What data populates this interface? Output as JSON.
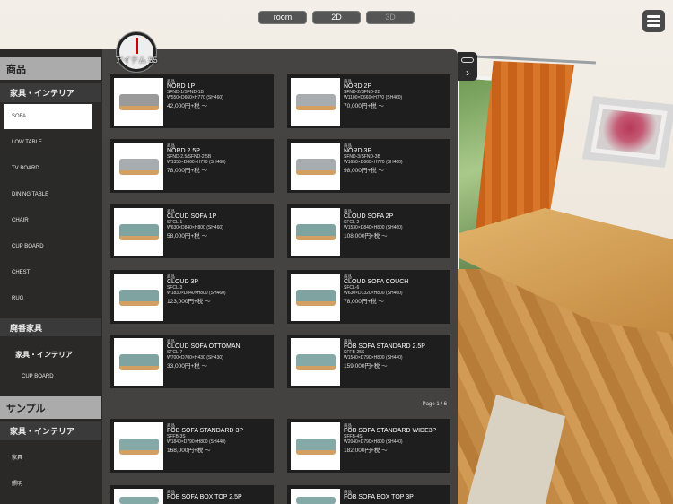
{
  "topbar": {
    "buttons": [
      {
        "label": "room"
      },
      {
        "label": "2D"
      },
      {
        "label": "3D"
      }
    ]
  },
  "sidebar": {
    "sections": [
      {
        "title": "商品",
        "groups": [
          {
            "title": "家具・インテリア",
            "items": [
              "SOFA",
              "LOW TABLE",
              "TV BOARD",
              "DINING TABLE",
              "CHAIR",
              "CUP BOARD",
              "CHEST",
              "RUG"
            ]
          }
        ]
      },
      {
        "title": "廃番家具",
        "groups": [
          {
            "title": "家具・インテリア",
            "items": [
              "CUP BOARD"
            ]
          }
        ]
      },
      {
        "title": "サンプル",
        "groups": [
          {
            "title": "家具・インテリア",
            "items": [
              "家具",
              "照明"
            ]
          }
        ]
      }
    ],
    "selected": "SOFA"
  },
  "main": {
    "item_count": "アイテム 55",
    "page_label": "Page 1 / 6",
    "products": [
      {
        "cat": "商品",
        "name": "NORD 1P",
        "code": "SFND-1/SFND-1B",
        "dims": "W550×D660×H770 (SH460)",
        "price": "42,000円+税 ～",
        "color": "#9a9a9a"
      },
      {
        "cat": "商品",
        "name": "NORD 2P",
        "code": "SFND-2/SFND-2B",
        "dims": "W1100×D660×H770 (SH460)",
        "price": "70,000円+税 ～",
        "color": "#a7acb0"
      },
      {
        "cat": "商品",
        "name": "NORD 2.5P",
        "code": "SFND-2.5/SFND-2.5B",
        "dims": "W1350×D660×H770 (SH460)",
        "price": "78,000円+税 ～",
        "color": "#a7acb0"
      },
      {
        "cat": "商品",
        "name": "NORD 3P",
        "code": "SFND-3/SFND-3B",
        "dims": "W1650×D660×H770 (SH460)",
        "price": "98,000円+税 ～",
        "color": "#a7acb0"
      },
      {
        "cat": "商品",
        "name": "CLOUD SOFA 1P",
        "code": "SFCL-1",
        "dims": "W630×D840×H800 (SH460)",
        "price": "58,000円+税 ～",
        "color": "#7fa3a0"
      },
      {
        "cat": "商品",
        "name": "CLOUD SOFA 2P",
        "code": "SFCL-2",
        "dims": "W1530×D840×H800 (SH460)",
        "price": "108,000円+税 ～",
        "color": "#7fa3a0"
      },
      {
        "cat": "商品",
        "name": "CLOUD 3P",
        "code": "SFCL-3",
        "dims": "W1830×D840×H800 (SH460)",
        "price": "123,000円+税 ～",
        "color": "#7fa3a0"
      },
      {
        "cat": "商品",
        "name": "CLOUD SOFA COUCH",
        "code": "SFCL-6",
        "dims": "W630×D1320×H800 (SH460)",
        "price": "78,000円+税 ～",
        "color": "#7fa3a0"
      },
      {
        "cat": "商品",
        "name": "CLOUD SOFA OTTOMAN",
        "code": "SFCL-7",
        "dims": "W700×D700×H430 (SH430)",
        "price": "33,000円+税 ～",
        "color": "#7fa3a0"
      },
      {
        "cat": "商品",
        "name": "FOB SOFA STANDARD 2.5P",
        "code": "SFFB-25S",
        "dims": "W1540×D790×H800 (SH440)",
        "price": "159,000円+税 ～",
        "color": "#84a9a6"
      },
      {
        "cat": "商品",
        "name": "FOB SOFA STANDARD 3P",
        "code": "SFFB-3S",
        "dims": "W1840×D790×H800 (SH440)",
        "price": "168,000円+税 ～",
        "color": "#84a9a6"
      },
      {
        "cat": "商品",
        "name": "FOB SOFA STANDARD WIDE3P",
        "code": "SFFB-4S",
        "dims": "W2040×D790×H800 (SH440)",
        "price": "182,000円+税 ～",
        "color": "#84a9a6"
      },
      {
        "cat": "商品",
        "name": "FOB SOFA BOX TOP 2.5P",
        "code": "",
        "dims": "",
        "price": "",
        "color": "#84a9a6"
      },
      {
        "cat": "商品",
        "name": "FOB SOFA BOX TOP 3P",
        "code": "",
        "dims": "",
        "price": "",
        "color": "#84a9a6"
      }
    ]
  }
}
